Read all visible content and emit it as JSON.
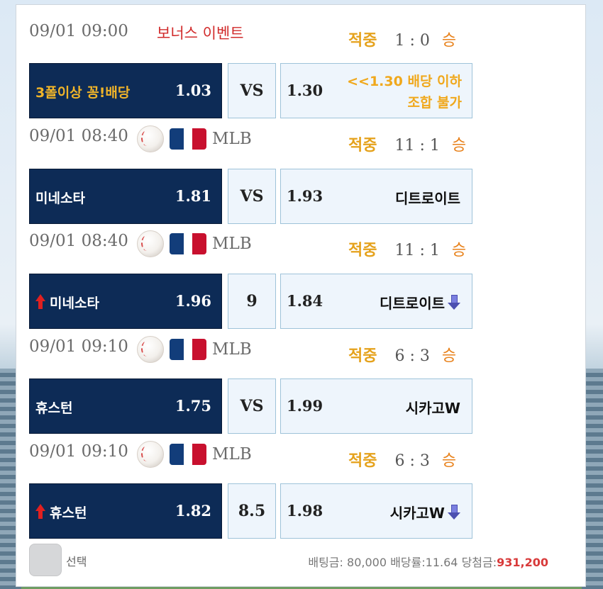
{
  "games": [
    {
      "datetime": "09/01 09:00",
      "event_label": "보너스 이벤트",
      "result_label": "적중",
      "score": "1 : 0",
      "outcome": "승",
      "home": {
        "team": "3폴이상 꽁!배당",
        "odd": "1.03"
      },
      "middle": "VS",
      "away": {
        "odd": "1.30",
        "note_line1": "<<1.30 배당 이하",
        "note_line2": "조합 불가"
      }
    },
    {
      "datetime": "09/01 08:40",
      "league": "MLB",
      "result_label": "적중",
      "score": "11 : 1",
      "outcome": "승",
      "home": {
        "team": "미네소타",
        "odd": "1.81"
      },
      "middle": "VS",
      "away": {
        "odd": "1.93",
        "team": "디트로이트"
      }
    },
    {
      "datetime": "09/01 08:40",
      "league": "MLB",
      "result_label": "적중",
      "score": "11 : 1",
      "outcome": "승",
      "home": {
        "team": "미네소타",
        "odd": "1.96"
      },
      "middle": "9",
      "away": {
        "odd": "1.84",
        "team": "디트로이트"
      }
    },
    {
      "datetime": "09/01 09:10",
      "league": "MLB",
      "result_label": "적중",
      "score": "6 : 3",
      "outcome": "승",
      "home": {
        "team": "휴스턴",
        "odd": "1.75"
      },
      "middle": "VS",
      "away": {
        "odd": "1.99",
        "team": "시카고W"
      }
    },
    {
      "datetime": "09/01 09:10",
      "league": "MLB",
      "result_label": "적중",
      "score": "6 : 3",
      "outcome": "승",
      "home": {
        "team": "휴스턴",
        "odd": "1.82"
      },
      "middle": "8.5",
      "away": {
        "odd": "1.98",
        "team": "시카고W"
      }
    }
  ],
  "footer": {
    "select_label": "선택",
    "bet_amount_label": "배팅금:",
    "bet_amount": "80,000",
    "bet_rate_label": "배당률:",
    "bet_rate": "11.64",
    "win_amount_label": "당첨금:",
    "win_amount": "931,200"
  },
  "icons": {
    "ball": "baseball-icon",
    "league": "mlb-logo-icon",
    "up": "arrow-up-icon",
    "down": "arrow-down-icon"
  },
  "colors": {
    "home_bg": "#0d2b56",
    "away_bg": "#eef5fc",
    "hit": "#e5a21c",
    "event": "#d12b2b",
    "win_amount": "#d83a3a"
  }
}
